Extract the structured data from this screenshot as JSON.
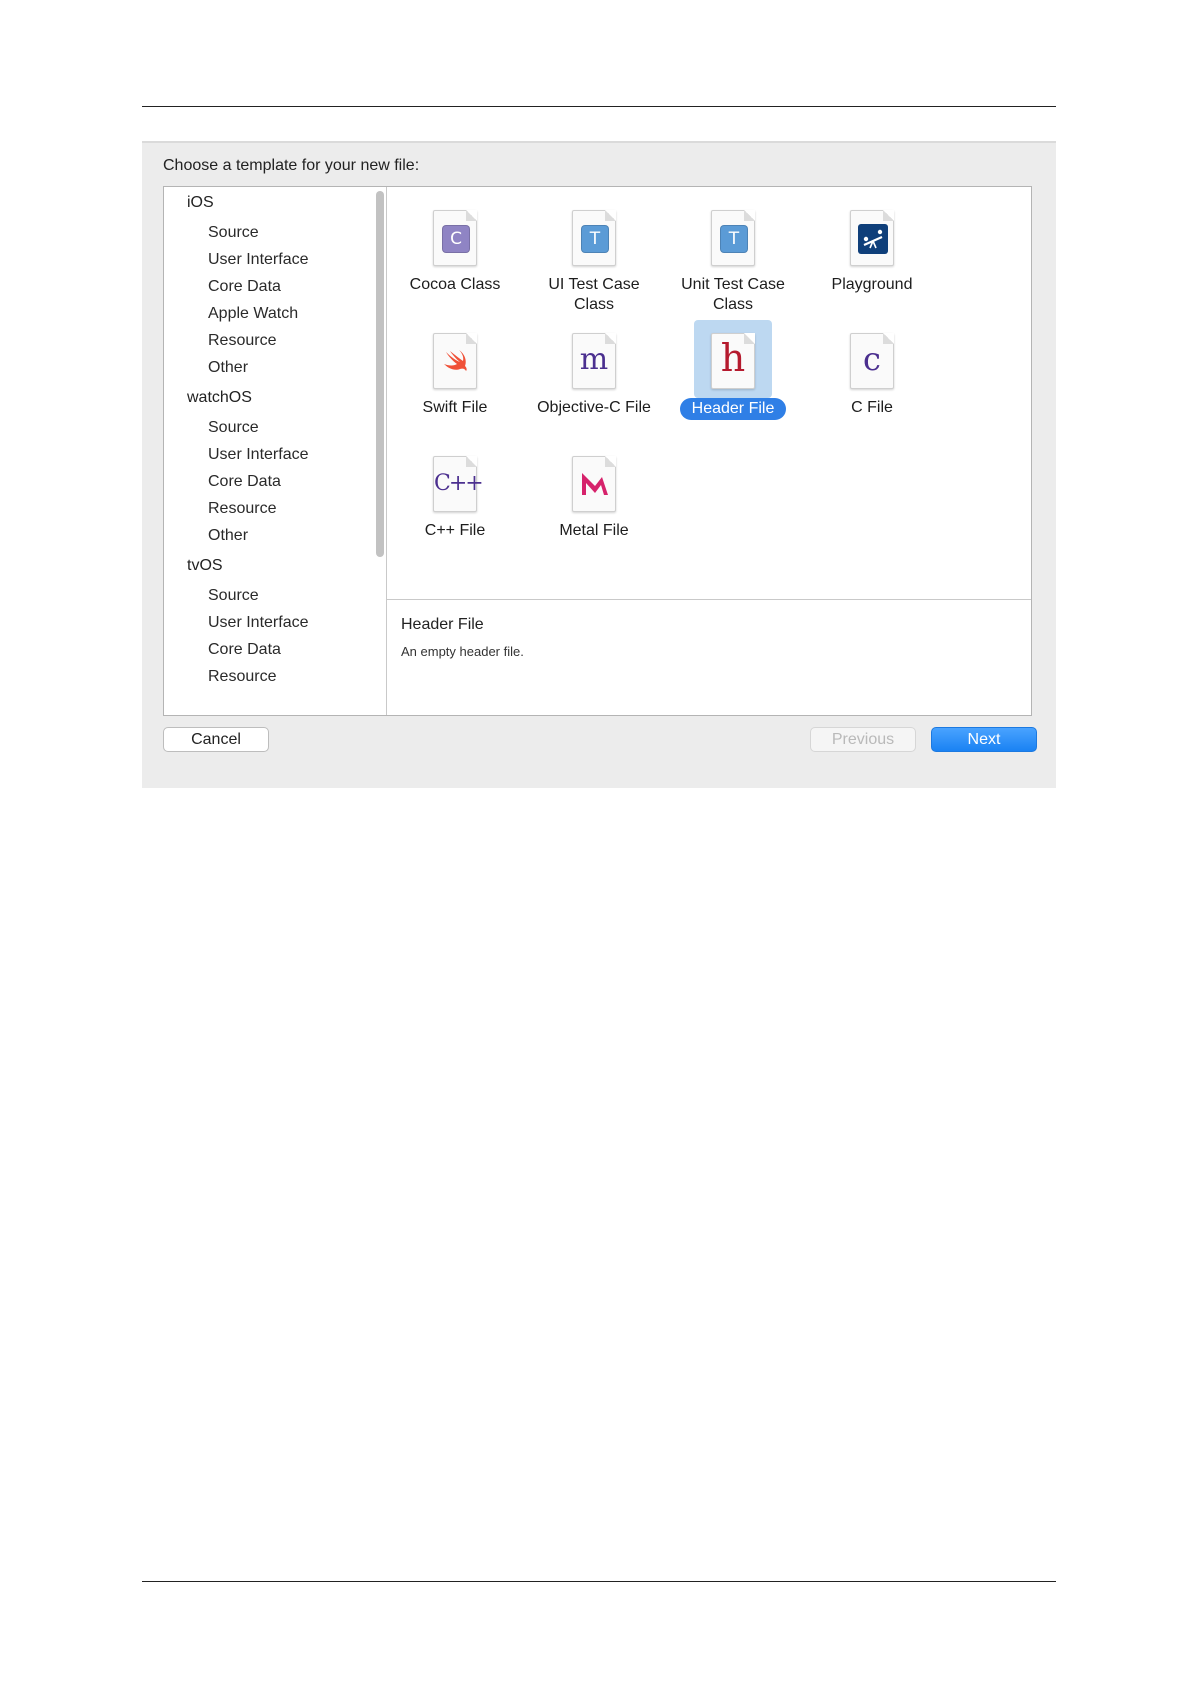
{
  "dialog": {
    "prompt": "Choose a template for your new file:"
  },
  "sidebar": {
    "sections": [
      {
        "title": "iOS",
        "items": [
          "Source",
          "User Interface",
          "Core Data",
          "Apple Watch",
          "Resource",
          "Other"
        ]
      },
      {
        "title": "watchOS",
        "items": [
          "Source",
          "User Interface",
          "Core Data",
          "Resource",
          "Other"
        ]
      },
      {
        "title": "tvOS",
        "items": [
          "Source",
          "User Interface",
          "Core Data",
          "Resource"
        ]
      }
    ]
  },
  "templates": [
    {
      "label": "Cocoa Class",
      "icon": "cocoa-class-icon",
      "glyph": "C",
      "color": "#8f84c4"
    },
    {
      "label": "UI Test Case\nClass",
      "icon": "ui-test-case-class-icon",
      "glyph": "T",
      "color": "#5b9bd6"
    },
    {
      "label": "Unit Test Case\nClass",
      "icon": "unit-test-case-class-icon",
      "glyph": "T",
      "color": "#5b9bd6"
    },
    {
      "label": "Playground",
      "icon": "playground-icon",
      "glyph": "",
      "color": "#0f3f7a"
    },
    {
      "label": "Swift File",
      "icon": "swift-file-icon",
      "glyph": "",
      "color": "#f05138"
    },
    {
      "label": "Objective-C File",
      "icon": "objective-c-file-icon",
      "glyph": "m",
      "color": "#4b2f8f"
    },
    {
      "label": "Header File",
      "icon": "header-file-icon",
      "glyph": "h",
      "color": "#b51a2e",
      "selected": true
    },
    {
      "label": "C File",
      "icon": "c-file-icon",
      "glyph": "c",
      "color": "#4b2f8f"
    },
    {
      "label": "C++ File",
      "icon": "cpp-file-icon",
      "glyph": "C++",
      "color": "#4b2f8f"
    },
    {
      "label": "Metal File",
      "icon": "metal-file-icon",
      "glyph": "",
      "color": "#d6226b"
    }
  ],
  "description": {
    "title": "Header File",
    "text": "An empty header file."
  },
  "buttons": {
    "cancel": "Cancel",
    "previous": "Previous",
    "next": "Next"
  },
  "colors": {
    "accent": "#2f7fe6",
    "selection_bg": "#bdd8f1"
  }
}
